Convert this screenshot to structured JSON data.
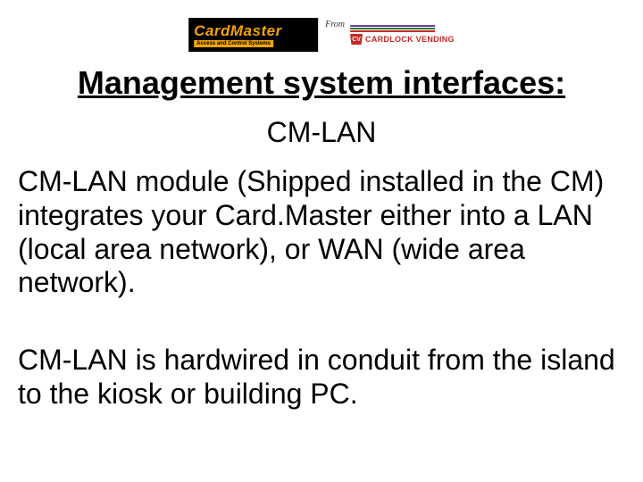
{
  "logo": {
    "cardmaster_text": "CardMaster",
    "cardmaster_tag": "Access and Control Systems",
    "from_label": "From",
    "cardlock_cv": "CV",
    "cardlock_text": "CARDLOCK VENDING"
  },
  "title": "Management system interfaces:",
  "subtitle": "CM-LAN",
  "paragraph1": "CM-LAN module (Shipped installed in the CM) integrates your Card.Master either into a LAN (local area network), or WAN (wide area network).",
  "paragraph2": "CM-LAN is hardwired in conduit from the island to the kiosk or building PC."
}
